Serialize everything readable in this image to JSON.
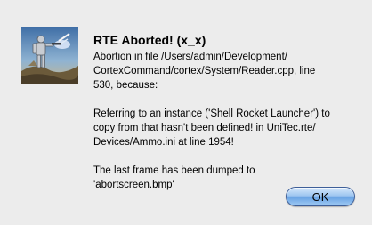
{
  "dialog": {
    "title": "RTE Aborted! (x_x)",
    "message_1": [
      "Abortion in file /Users/admin/Development/",
      "CortexCommand/cortex/System/Reader.cpp, line",
      "530, because:"
    ],
    "message_2": [
      "Referring to an instance ('Shell Rocket Launcher') to",
      "copy from that hasn't been defined! in UniTec.rte/",
      "Devices/Ammo.ini at line 1954!"
    ],
    "message_3": [
      "The last frame has been dumped to",
      "'abortscreen.bmp'"
    ],
    "ok_label": "OK",
    "icon": "cortex-command-app-icon"
  }
}
